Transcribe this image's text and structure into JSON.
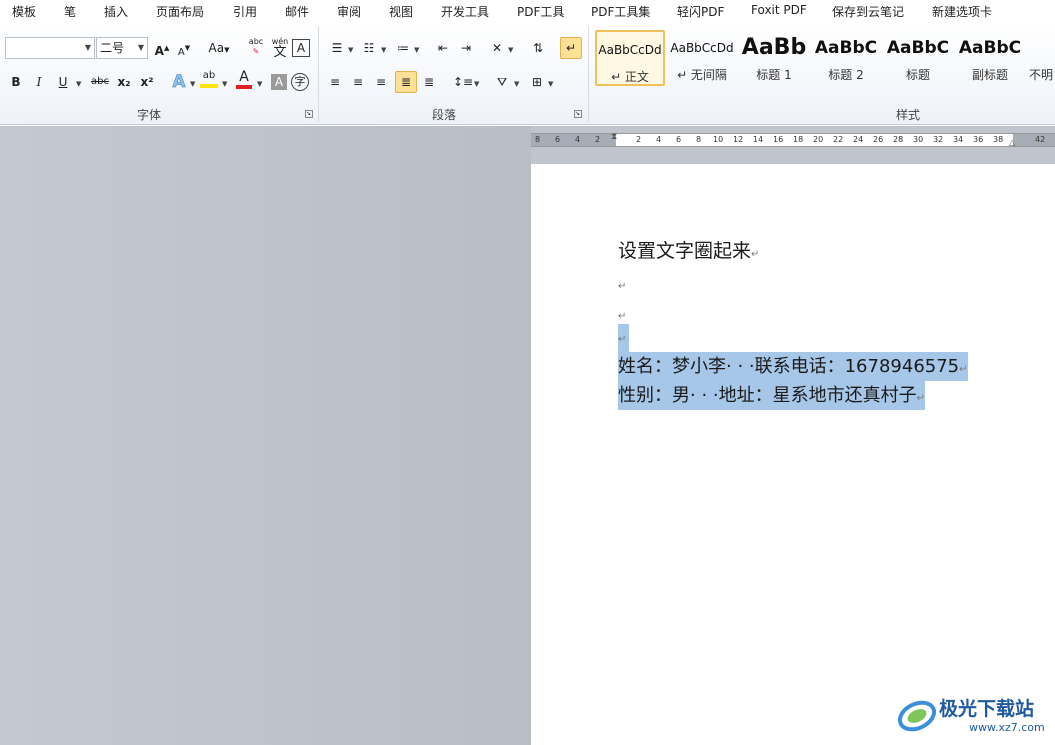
{
  "menu": {
    "items": [
      "模板",
      "笔",
      "插入",
      "页面布局",
      "引用",
      "邮件",
      "审阅",
      "视图",
      "开发工具",
      "PDF工具",
      "PDF工具集",
      "轻闪PDF",
      "Foxit PDF",
      "保存到云笔记",
      "新建选项卡"
    ]
  },
  "font_group": {
    "label": "字体",
    "font_name": "",
    "font_size": "二号",
    "grow": "A",
    "shrink": "A",
    "change_case": "Aa",
    "pinyin_top": "abc",
    "phonetic_top": "wén",
    "phonetic_bottom": "文",
    "char_border": "A",
    "bold": "B",
    "italic": "I",
    "underline": "U",
    "strike": "abc",
    "subscript": "x₂",
    "superscript": "x²",
    "text_effect": "A",
    "highlight": "ab",
    "font_color": "A",
    "shading": "A",
    "enclose": "字"
  },
  "paragraph_group": {
    "label": "段落"
  },
  "styles_group": {
    "label": "样式",
    "items": [
      {
        "preview": "AaBbCcDd",
        "name": "↵ 正文"
      },
      {
        "preview": "AaBbCcDd",
        "name": "↵ 无间隔"
      },
      {
        "preview": "AaBb",
        "name": "标题 1"
      },
      {
        "preview": "AaBbC",
        "name": "标题 2"
      },
      {
        "preview": "AaBbC",
        "name": "标题"
      },
      {
        "preview": "AaBbC",
        "name": "副标题"
      },
      {
        "preview": "",
        "name": "不明"
      }
    ]
  },
  "ruler": {
    "ticks": [
      "8",
      "6",
      "4",
      "2",
      "2",
      "4",
      "6",
      "8",
      "10",
      "12",
      "14",
      "16",
      "18",
      "20",
      "22",
      "24",
      "26",
      "28",
      "30",
      "32",
      "34",
      "36",
      "38",
      "42"
    ]
  },
  "document": {
    "title": "设置文字圈起来",
    "para_mark": "↵",
    "line1": "姓名：梦小李· · ·联系电话：1678946575",
    "line2": "性别：男· · ·地址：星系地市还真村子"
  },
  "watermark": {
    "brand": "极光下载站",
    "url": "www.xz7.com"
  },
  "colors": {
    "selection": "#a7c7e8",
    "style_selected_border": "#f0c15a",
    "font_color_bar": "#e02020",
    "highlight_bar": "#f7e600",
    "watermark_text": "#1f5aa0"
  }
}
